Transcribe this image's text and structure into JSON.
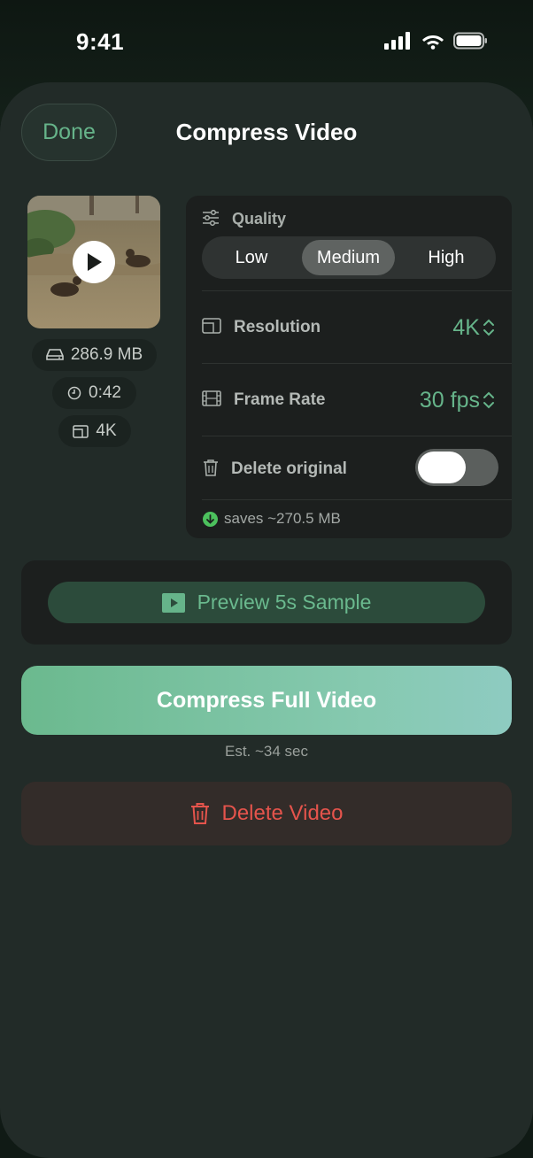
{
  "status_bar": {
    "time": "9:41"
  },
  "header": {
    "done_label": "Done",
    "title": "Compress Video"
  },
  "video_info": {
    "size": "286.9 MB",
    "duration": "0:42",
    "resolution": "4K"
  },
  "settings": {
    "quality_label": "Quality",
    "quality_options": [
      "Low",
      "Medium",
      "High"
    ],
    "quality_selected": "Medium",
    "resolution_label": "Resolution",
    "resolution_value": "4K",
    "frame_rate_label": "Frame Rate",
    "frame_rate_value": "30 fps",
    "delete_original_label": "Delete original",
    "delete_original_enabled": false,
    "savings_text": "saves ~270.5 MB"
  },
  "actions": {
    "preview_label": "Preview 5s Sample",
    "compress_label": "Compress Full Video",
    "estimate_text": "Est. ~34 sec",
    "delete_label": "Delete Video"
  },
  "colors": {
    "accent": "#66b48a",
    "danger": "#e5544c",
    "sheet": "#222b28",
    "panel": "#1c1f1e"
  }
}
